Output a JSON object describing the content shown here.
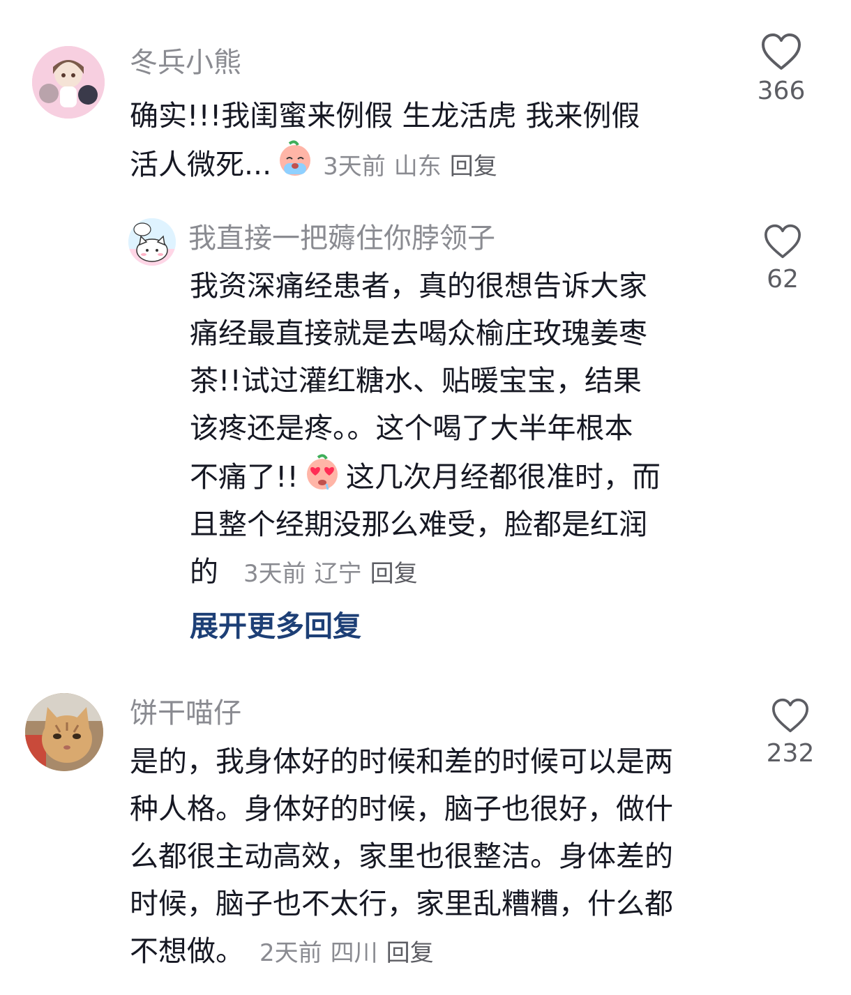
{
  "comments": [
    {
      "username": "冬兵小熊",
      "text_lines": [
        "确实!!!我闺蜜来例假 生龙活虎 我来例假",
        "活人微死..."
      ],
      "emoji": "crying-face-emoji",
      "time": "3天前",
      "location": "山东",
      "reply_label": "回复",
      "likes": "366",
      "avatar": "anime-girl-avatar"
    },
    {
      "username": "我直接一把薅住你脖领子",
      "text_lines": [
        "我资深痛经患者，真的很想告诉大家",
        "痛经最直接就是去喝众榆庄玫瑰姜枣",
        "茶!!试过灌红糖水、贴暖宝宝，结果",
        "该疼还是疼。。这个喝了大半年根本",
        "不痛了!!",
        "这几次月经都很准时，而",
        "且整个经期没那么难受，脸都是红润",
        "的"
      ],
      "emoji": "heart-eyes-face-emoji",
      "time": "3天前",
      "location": "辽宁",
      "reply_label": "回复",
      "likes": "62",
      "avatar": "white-cats-avatar",
      "expand_label": "展开更多回复"
    },
    {
      "username": "饼干喵仔",
      "text_lines": [
        "是的，我身体好的时候和差的时候可以是两",
        "种人格。身体好的时候，脑子也很好，做什",
        "么都很主动高效，家里也很整洁。身体差的",
        "时候，脑子也不太行，家里乱糟糟，什么都",
        "不想做。"
      ],
      "time": "2天前",
      "location": "四川",
      "reply_label": "回复",
      "likes": "232",
      "avatar": "orange-cat-photo-avatar"
    }
  ],
  "colors": {
    "username": "#8a8b91",
    "text": "#161823",
    "meta": "#8a8b91",
    "link": "#1d3f76"
  }
}
